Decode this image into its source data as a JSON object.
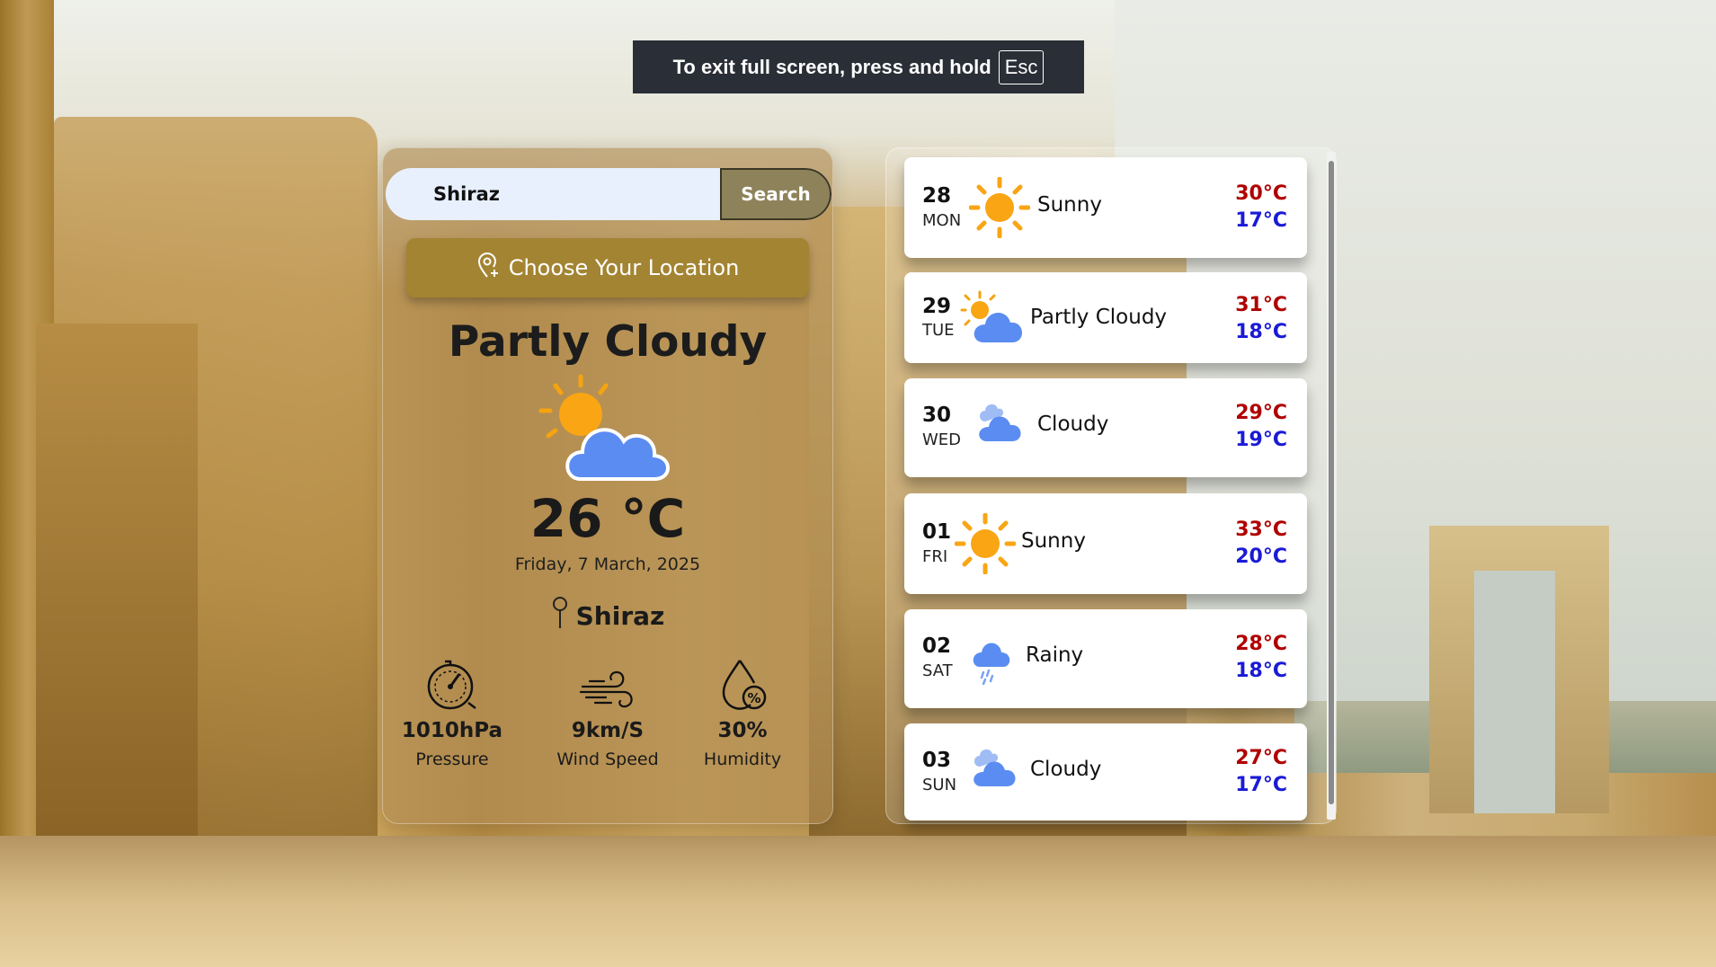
{
  "fullscreen_banner": {
    "text": "To exit full screen, press and hold",
    "key": "Esc"
  },
  "search": {
    "value": "Shiraz",
    "button_label": "Search"
  },
  "location_button": {
    "label": "Choose Your Location",
    "icon": "location-pin-plus-icon"
  },
  "current": {
    "condition": "Partly Cloudy",
    "icon": "partly-cloudy-icon",
    "temperature": "26 °C",
    "date": "Friday, 7 March, 2025",
    "city": "Shiraz",
    "stats": [
      {
        "icon": "pressure-gauge-icon",
        "value": "1010hPa",
        "label": "Pressure"
      },
      {
        "icon": "wind-icon",
        "value": "9km/S",
        "label": "Wind Speed"
      },
      {
        "icon": "humidity-drop-icon",
        "value": "30%",
        "label": "Humidity"
      }
    ]
  },
  "forecast": [
    {
      "day": "28",
      "weekday": "MON",
      "condition": "Sunny",
      "icon": "sun-icon",
      "high": "30°C",
      "low": "17°C"
    },
    {
      "day": "29",
      "weekday": "TUE",
      "condition": "Partly Cloudy",
      "icon": "partly-cloudy-icon",
      "high": "31°C",
      "low": "18°C"
    },
    {
      "day": "30",
      "weekday": "WED",
      "condition": "Cloudy",
      "icon": "cloud-icon",
      "high": "29°C",
      "low": "19°C"
    },
    {
      "day": "01",
      "weekday": "FRI",
      "condition": "Sunny",
      "icon": "sun-icon",
      "high": "33°C",
      "low": "20°C"
    },
    {
      "day": "02",
      "weekday": "SAT",
      "condition": "Rainy",
      "icon": "rain-cloud-icon",
      "high": "28°C",
      "low": "18°C"
    },
    {
      "day": "03",
      "weekday": "SUN",
      "condition": "Cloudy",
      "icon": "cloud-icon",
      "high": "27°C",
      "low": "17°C"
    }
  ],
  "colors": {
    "high_temp": "#b00000",
    "low_temp": "#1a1ad6",
    "accent": "#a38432",
    "search_button": "#8d8259"
  }
}
